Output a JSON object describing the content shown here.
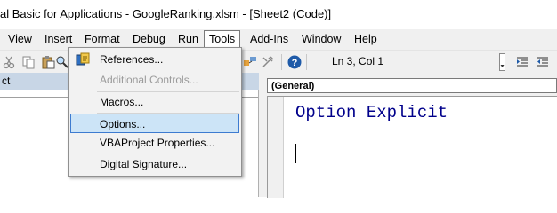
{
  "window": {
    "title": "al Basic for Applications - GoogleRanking.xlsm - [Sheet2 (Code)]"
  },
  "menubar": {
    "items": [
      {
        "label": "View"
      },
      {
        "label": "Insert"
      },
      {
        "label": "Format"
      },
      {
        "label": "Debug"
      },
      {
        "label": "Run"
      },
      {
        "label": "Tools"
      },
      {
        "label": "Add-Ins"
      },
      {
        "label": "Window"
      },
      {
        "label": "Help"
      }
    ],
    "active": "Tools"
  },
  "toolbar": {
    "cursor_position": "Ln 3, Col 1"
  },
  "project_pane": {
    "title": "ct"
  },
  "code_window": {
    "object_combo": "(General)",
    "lines": [
      "Option Explicit"
    ]
  },
  "tools_menu": {
    "items": [
      {
        "label": "References...",
        "enabled": true,
        "icon": "references-icon"
      },
      {
        "label": "Additional Controls...",
        "enabled": false
      },
      {
        "label": "Macros...",
        "enabled": true
      },
      {
        "label": "Options...",
        "enabled": true,
        "highlighted": true
      },
      {
        "label": "VBAProject Properties...",
        "enabled": true
      },
      {
        "label": "Digital Signature...",
        "enabled": true
      }
    ]
  },
  "colors": {
    "highlight": "#cce4f7",
    "highlight_border": "#3d7bd0",
    "code_text": "#00008b",
    "project_header": "#c8d6e6"
  }
}
